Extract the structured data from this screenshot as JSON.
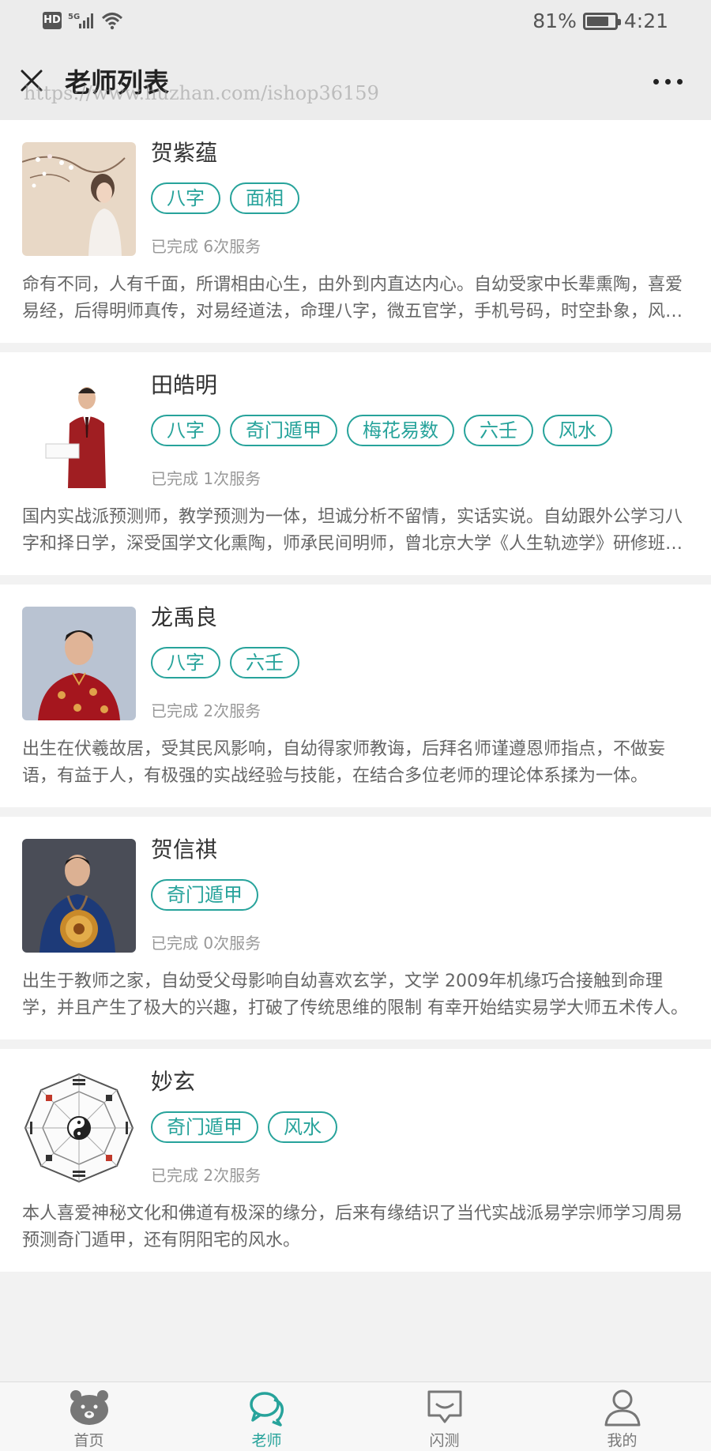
{
  "status_bar": {
    "network": "5G",
    "battery": "81%",
    "battery_level": 0.81,
    "time": "4:21"
  },
  "nav": {
    "title": "老师列表",
    "watermark": "https://www.huzhan.com/ishop36159"
  },
  "teachers": [
    {
      "name": "贺紫蕴",
      "tags": [
        "八字",
        "面相"
      ],
      "services": "已完成 6次服务",
      "description": "命有不同，人有千面，所谓相由心生，由外到内直达内心。自幼受家中长辈熏陶，喜爱易经，后得明师真传，对易经道法，命理八字，微五官学，手机号码，时空卦象，风水布局等均有深入研究。"
    },
    {
      "name": "田皓明",
      "tags": [
        "八字",
        "奇门遁甲",
        "梅花易数",
        "六壬",
        "风水"
      ],
      "services": "已完成 1次服务",
      "description": "国内实战派预测师，教学预测为一体，坦诚分析不留情，实话实说。自幼跟外公学习八字和择日学，深受国学文化熏陶，师承民间明师，曾北京大学《人生轨迹学》研修班学习。"
    },
    {
      "name": "龙禹良",
      "tags": [
        "八字",
        "六壬"
      ],
      "services": "已完成 2次服务",
      "description": "出生在伏羲故居，受其民风影响，自幼得家师教诲，后拜名师谨遵恩师指点，不做妄语，有益于人，有极强的实战经验与技能，在结合多位老师的理论体系揉为一体。"
    },
    {
      "name": "贺信祺",
      "tags": [
        "奇门遁甲"
      ],
      "services": "已完成 0次服务",
      "description": "出生于教师之家，自幼受父母影响自幼喜欢玄学，文学 2009年机缘巧合接触到命理学，并且产生了极大的兴趣，打破了传统思维的限制 有幸开始结实易学大师五术传人。"
    },
    {
      "name": "妙玄",
      "tags": [
        "奇门遁甲",
        "风水"
      ],
      "services": "已完成 2次服务",
      "description": "本人喜爱神秘文化和佛道有极深的缘分，后来有缘结识了当代实战派易学宗师学习周易预测奇门遁甲，还有阴阳宅的风水。"
    }
  ],
  "tabs": [
    {
      "label": "首页",
      "icon": "bear-icon",
      "active": false
    },
    {
      "label": "老师",
      "icon": "chat-bubbles-icon",
      "active": true
    },
    {
      "label": "闪测",
      "icon": "message-box-icon",
      "active": false
    },
    {
      "label": "我的",
      "icon": "user-icon",
      "active": false
    }
  ],
  "colors": {
    "accent": "#27a39b",
    "background": "#f2f2f2",
    "nav_background": "#ececec"
  }
}
